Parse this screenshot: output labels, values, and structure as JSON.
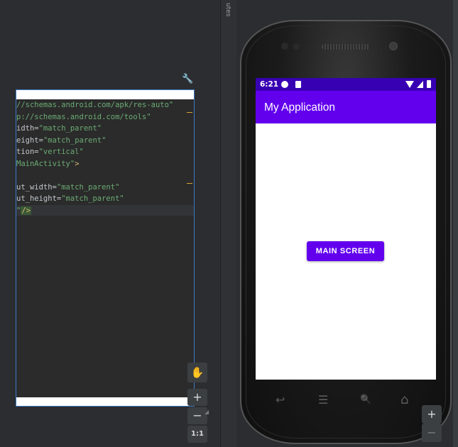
{
  "code": {
    "lines": [
      {
        "attr": "",
        "val": "//schemas.android.com/apk/res-auto\"",
        "tag": ""
      },
      {
        "attr": "",
        "val": "p://schemas.android.com/tools\"",
        "tag": ""
      },
      {
        "attr": "idth=",
        "val": "\"match_parent\"",
        "tag": ""
      },
      {
        "attr": "eight=",
        "val": "\"match_parent\"",
        "tag": ""
      },
      {
        "attr": "tion=",
        "val": "\"vertical\"",
        "tag": ""
      },
      {
        "attr": "",
        "val": "MainActivity\"",
        "tag": ">"
      },
      {
        "attr": "",
        "val": "",
        "tag": ""
      },
      {
        "attr": "ut_width=",
        "val": "\"match_parent\"",
        "tag": ""
      },
      {
        "attr": "ut_height=",
        "val": "\"match_parent\"",
        "tag": ""
      },
      {
        "attr": "",
        "val": "\"",
        "tag": "/>"
      }
    ]
  },
  "tool_window": {
    "attributes_tab": "utes"
  },
  "zoom_left": {
    "zoom_in": "+",
    "zoom_out": "−",
    "fit": "1:1",
    "pan": "✋"
  },
  "zoom_right": {
    "zoom_in": "+",
    "zoom_out": "−"
  },
  "device": {
    "status_time": "6:21",
    "app_title": "My Application",
    "button_label": "MAIN SCREEN",
    "nav": {
      "back": "↩",
      "menu": "☰",
      "search": "🔍",
      "home": "⌂"
    }
  },
  "colors": {
    "status_bar": "#3700b3",
    "app_bar": "#6200ee",
    "button": "#6200ee"
  }
}
